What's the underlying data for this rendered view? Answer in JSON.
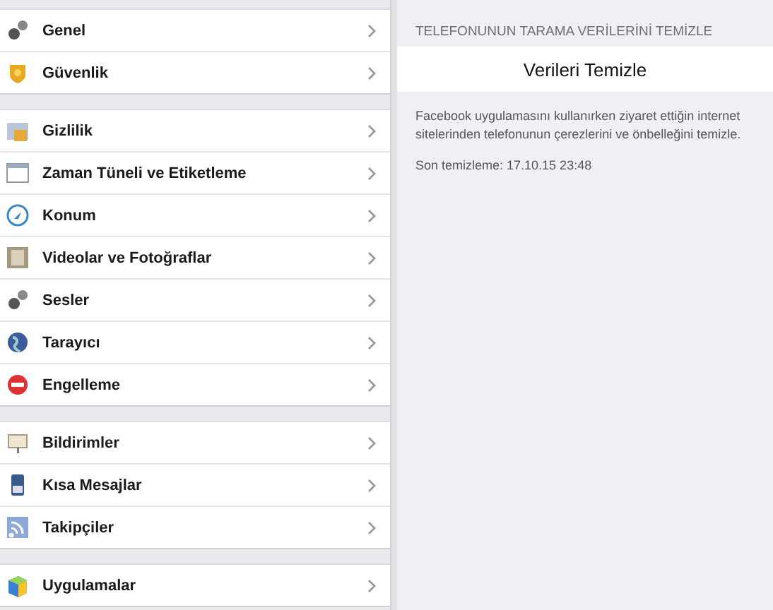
{
  "settings_groups": [
    {
      "items": [
        {
          "label": "Genel"
        },
        {
          "label": "Güvenlik"
        }
      ]
    },
    {
      "items": [
        {
          "label": "Gizlilik"
        },
        {
          "label": "Zaman Tüneli ve Etiketleme"
        },
        {
          "label": "Konum"
        },
        {
          "label": "Videolar ve Fotoğraflar"
        },
        {
          "label": "Sesler"
        },
        {
          "label": "Tarayıcı"
        },
        {
          "label": "Engelleme"
        }
      ]
    },
    {
      "items": [
        {
          "label": "Bildirimler"
        },
        {
          "label": "Kısa Mesajlar"
        },
        {
          "label": "Takipçiler"
        }
      ]
    },
    {
      "items": [
        {
          "label": "Uygulamalar"
        }
      ]
    }
  ],
  "detail": {
    "section_header": "TELEFONUNUN TARAMA VERİLERİNİ TEMİZLE",
    "action_button": "Verileri Temizle",
    "description": "Facebook uygulamasını kullanırken ziyaret ettiğin internet sitelerinden telefonunun çerezlerini ve önbelleğini temizle.",
    "last_cleared": "Son temizleme: 17.10.15 23:48"
  }
}
